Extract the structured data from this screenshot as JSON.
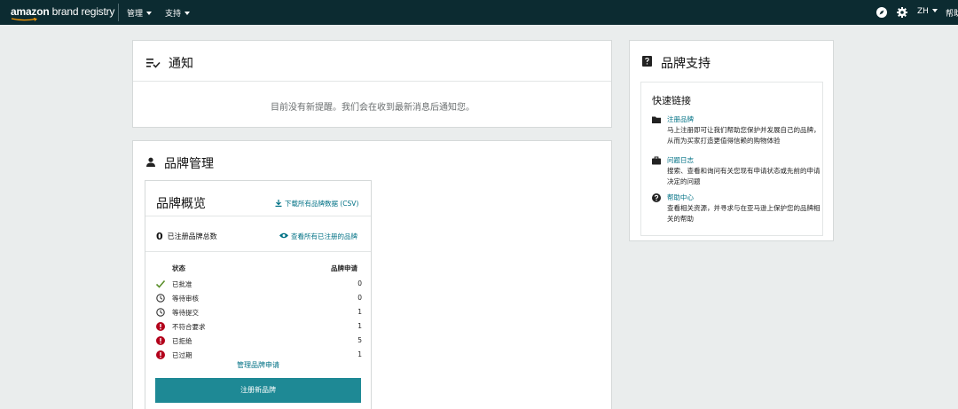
{
  "topbar": {
    "logo_light": "amazon",
    "logo_bold": " brand registry",
    "nav": [
      "管理",
      "支持"
    ],
    "lang": "ZH",
    "help": "帮助"
  },
  "notifications": {
    "title": "通知",
    "empty_text": "目前没有新提醒。我们会在收到最新消息后通知您。"
  },
  "brand_management": {
    "title": "品牌管理",
    "overview": {
      "title": "品牌概览",
      "download_link": "下载所有品牌数据 (CSV)",
      "total_count": "0",
      "total_label": "已注册品牌总数",
      "view_link": "查看所有已注册的品牌",
      "col_status": "状态",
      "col_apps": "品牌申请",
      "rows": [
        {
          "icon": "check-icon",
          "label": "已批准",
          "value": "0"
        },
        {
          "icon": "clock-icon",
          "label": "等待审核",
          "value": "0"
        },
        {
          "icon": "clock-icon",
          "label": "等待提交",
          "value": "1"
        },
        {
          "icon": "alert-icon",
          "label": "不符合要求",
          "value": "1"
        },
        {
          "icon": "alert-icon",
          "label": "已拒绝",
          "value": "5"
        },
        {
          "icon": "alert-icon",
          "label": "已过期",
          "value": "1"
        }
      ],
      "manage_link": "管理品牌申请",
      "register_button": "注册新品牌"
    }
  },
  "brand_support": {
    "title": "品牌支持",
    "quick_links_title": "快速链接",
    "links": [
      {
        "icon": "folder-icon",
        "label": "注册品牌",
        "desc": "马上注册即可让我们帮助您保护并发展自己的品牌，从而为买家打造更值得信赖的购物体验"
      },
      {
        "icon": "briefcase-icon",
        "label": "问题日志",
        "desc": "搜索、查看和询问有关您现有申请状态或先前的申请决定的问题"
      },
      {
        "icon": "help-circle-icon",
        "label": "帮助中心",
        "desc": "查看相关资源，并寻求与在亚马逊上保护您的品牌相关的帮助"
      }
    ]
  },
  "colors": {
    "topbar": "#0c2b31",
    "link": "#007185",
    "button": "#1e8995",
    "approved": "#5a8f2a",
    "alert": "#b3001b"
  }
}
